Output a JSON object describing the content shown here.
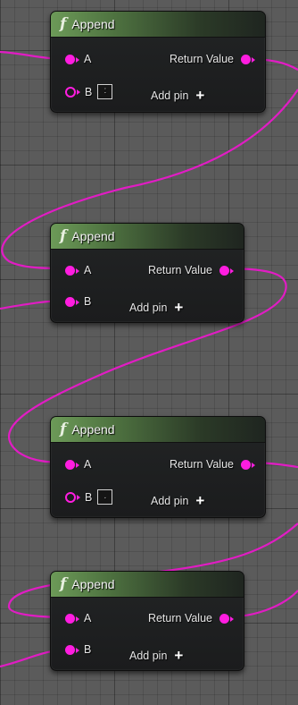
{
  "colors": {
    "wire": "#e11cc4",
    "pin": "#ff1de0"
  },
  "icons": {
    "function": "function-icon",
    "add": "plus-icon"
  },
  "nodes": [
    {
      "title": "Append",
      "function_glyph": "f",
      "pin_a": "A",
      "pin_b": "B",
      "pin_b_connected": false,
      "pin_b_default": ":",
      "output": "Return Value",
      "add_pin": "Add pin",
      "add_glyph": "+"
    },
    {
      "title": "Append",
      "function_glyph": "f",
      "pin_a": "A",
      "pin_b": "B",
      "pin_b_connected": true,
      "output": "Return Value",
      "add_pin": "Add pin",
      "add_glyph": "+"
    },
    {
      "title": "Append",
      "function_glyph": "f",
      "pin_a": "A",
      "pin_b": "B",
      "pin_b_connected": false,
      "pin_b_default": ".",
      "output": "Return Value",
      "add_pin": "Add pin",
      "add_glyph": "+"
    },
    {
      "title": "Append",
      "function_glyph": "f",
      "pin_a": "A",
      "pin_b": "B",
      "pin_b_connected": true,
      "output": "Return Value",
      "add_pin": "Add pin",
      "add_glyph": "+"
    }
  ]
}
